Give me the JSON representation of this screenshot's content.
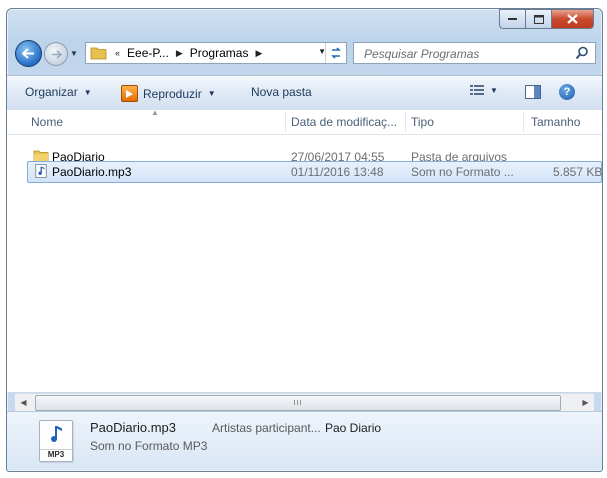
{
  "navigation": {
    "breadcrumb": [
      "Eee-P...",
      "Programas"
    ],
    "search_placeholder": "Pesquisar Programas"
  },
  "toolbar": {
    "organize": "Organizar",
    "play": "Reproduzir",
    "new_folder": "Nova pasta"
  },
  "columns": {
    "name": "Nome",
    "date": "Data de modificaç...",
    "type": "Tipo",
    "size": "Tamanho"
  },
  "files": [
    {
      "name": "PaoDiario",
      "date": "27/06/2017 04:55",
      "type": "Pasta de arquivos",
      "size": "",
      "icon": "folder-icon"
    },
    {
      "name": "PaoDiario.mp3",
      "date": "01/11/2016 13:48",
      "type": "Som no Formato ...",
      "size": "5.857 KB",
      "icon": "audio-file-icon"
    }
  ],
  "scrollbar": {
    "thumb_grip": "III"
  },
  "details": {
    "name": "PaoDiario.mp3",
    "type": "Som no Formato MP3",
    "prop_label": "Artistas participant...",
    "prop_value": "Pao Diario",
    "icon_label": "MP3"
  }
}
